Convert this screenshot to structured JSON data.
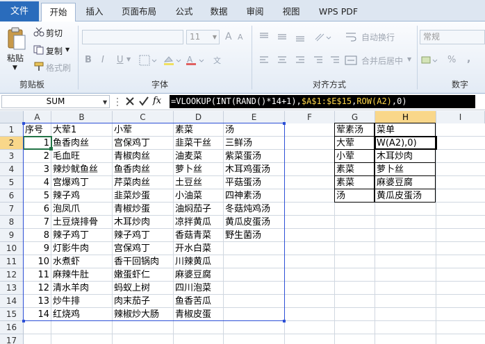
{
  "ribbon": {
    "tabs": [
      "文件",
      "开始",
      "插入",
      "页面布局",
      "公式",
      "数据",
      "审阅",
      "视图",
      "WPS PDF"
    ],
    "clipboard": {
      "paste": "粘贴",
      "cut": "剪切",
      "copy": "复制",
      "format_painter": "格式刷",
      "group": "剪贴板"
    },
    "font": {
      "size": "11",
      "group": "字体",
      "bold": "B",
      "italic": "I",
      "underline": "U",
      "grow": "A",
      "shrink": "A"
    },
    "align": {
      "wrap": "自动换行",
      "merge": "合并后居中",
      "group": "对齐方式"
    },
    "number": {
      "format": "常规",
      "percent": "%",
      "comma": ",",
      "group": "数字"
    }
  },
  "formula_bar": {
    "name_box": "SUM",
    "fx": "fx",
    "formula_parts": [
      "=VLOOKUP(INT(RAND()*14+1),",
      "$A$1:$E$15",
      "ROW(A2)",
      ",0)"
    ],
    "formula_sep": ","
  },
  "sheet": {
    "columns": [
      "A",
      "B",
      "C",
      "D",
      "E",
      "F",
      "G",
      "H",
      "I"
    ],
    "rows": [
      "1",
      "2",
      "3",
      "4",
      "5",
      "6",
      "7",
      "8",
      "9",
      "10",
      "11",
      "12",
      "13",
      "14",
      "15",
      "16",
      "17"
    ],
    "main": [
      [
        "序号",
        "大荤1",
        "小荤",
        "素菜",
        "汤"
      ],
      [
        "1",
        "鱼香肉丝",
        "宫保鸡丁",
        "韭菜干丝",
        "三鲜汤"
      ],
      [
        "2",
        "毛血旺",
        "青椒肉丝",
        "油麦菜",
        "紫菜蛋汤"
      ],
      [
        "3",
        "辣炒鱿鱼丝",
        "鱼香肉丝",
        "萝卜丝",
        "木耳鸡蛋汤"
      ],
      [
        "4",
        "宫爆鸡丁",
        "芹菜肉丝",
        "土豆丝",
        "平菇蛋汤"
      ],
      [
        "5",
        "辣子鸡",
        "韭菜炒蛋",
        "小油菜",
        "四神素汤"
      ],
      [
        "6",
        "泡凤爪",
        "青椒炒蛋",
        "油焖茄子",
        "冬菇炖鸡汤"
      ],
      [
        "7",
        "土豆烧排骨",
        "木耳炒肉",
        "凉拌黄瓜",
        "黄瓜皮蛋汤"
      ],
      [
        "8",
        "辣子鸡丁",
        "辣子鸡丁",
        "香菇青菜",
        "野生菌汤"
      ],
      [
        "9",
        "灯影牛肉",
        "宫保鸡丁",
        "开水白菜",
        ""
      ],
      [
        "10",
        "水煮虾",
        "香干回锅肉",
        "川辣黄瓜",
        ""
      ],
      [
        "11",
        "麻辣牛肚",
        "嫩蛋虾仁",
        "麻婆豆腐",
        ""
      ],
      [
        "12",
        "清水羊肉",
        "蚂蚁上树",
        "四川泡菜",
        ""
      ],
      [
        "13",
        "炒牛排",
        "肉末茄子",
        "鱼香苦瓜",
        ""
      ],
      [
        "14",
        "红烧鸡",
        "辣椒炒大肠",
        "青椒皮蛋",
        ""
      ]
    ],
    "menu": [
      [
        "荤素汤",
        "菜单"
      ],
      [
        "大荤",
        "W(A2),0)"
      ],
      [
        "小荤",
        "木耳炒肉"
      ],
      [
        "素菜",
        "萝卜丝"
      ],
      [
        "素菜",
        "麻婆豆腐"
      ],
      [
        "汤",
        "黄瓜皮蛋汤"
      ]
    ]
  }
}
